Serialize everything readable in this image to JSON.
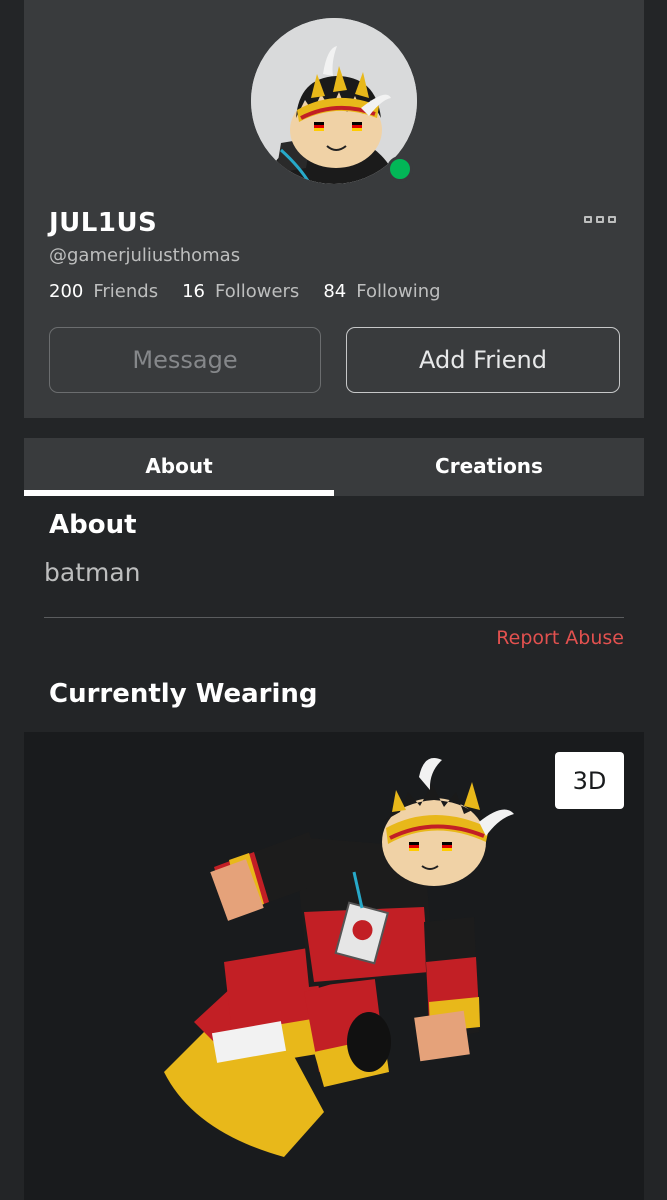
{
  "profile": {
    "display_name": "JUL1US",
    "username": "@gamerjuliusthomas",
    "status": "online",
    "stats": [
      {
        "count": "200",
        "label": "Friends"
      },
      {
        "count": "16",
        "label": "Followers"
      },
      {
        "count": "84",
        "label": "Following"
      }
    ],
    "message_label": "Message",
    "add_friend_label": "Add Friend",
    "more_icon": "more-options-icon"
  },
  "tabs": [
    {
      "label": "About",
      "active": true
    },
    {
      "label": "Creations",
      "active": false
    }
  ],
  "about": {
    "heading": "About",
    "text": "batman",
    "report_label": "Report Abuse"
  },
  "wearing": {
    "heading": "Currently Wearing",
    "view_3d_label": "3D"
  },
  "colors": {
    "background": "#232527",
    "card": "#393b3d",
    "online": "#02b757",
    "report": "#e2514f"
  }
}
